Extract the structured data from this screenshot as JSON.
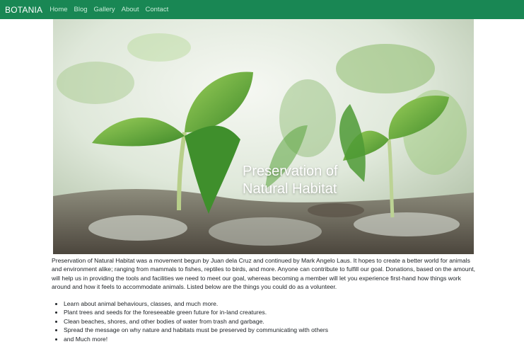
{
  "nav": {
    "brand": "BOTANIA",
    "links": [
      "Home",
      "Blog",
      "Gallery",
      "About",
      "Contact"
    ]
  },
  "hero": {
    "title_line1": "Preservation of",
    "title_line2": "Natural Habitat"
  },
  "intro": "Preservation of Natural Habitat was a movement begun by Juan dela Cruz and continued by Mark Angelo Laus. It hopes to create a better world for animals and environment alike; ranging from mammals to fishes, reptiles to birds, and more. Anyone can contribute to fulfill our goal. Donations, based on the amount, will help us in providing the tools and facilities we need to meet our goal, whereas becoming a member will let you experience first-hand how things work around and how it feels to accommodate animals. Listed below are the things you could do as a volunteer.",
  "volunteer_list": [
    "Learn about animal behaviours, classes, and much more.",
    "Plant trees and seeds for the foreseeable green future for in-land creatures.",
    "Clean beaches, shores, and other bodies of water from trash and garbage.",
    "Spread the message on why nature and habitats must be preserved by communicating with others",
    "and Much more!"
  ],
  "colors": {
    "navbar": "#198754",
    "nav_link": "#c9ecd8",
    "text": "#212529"
  }
}
